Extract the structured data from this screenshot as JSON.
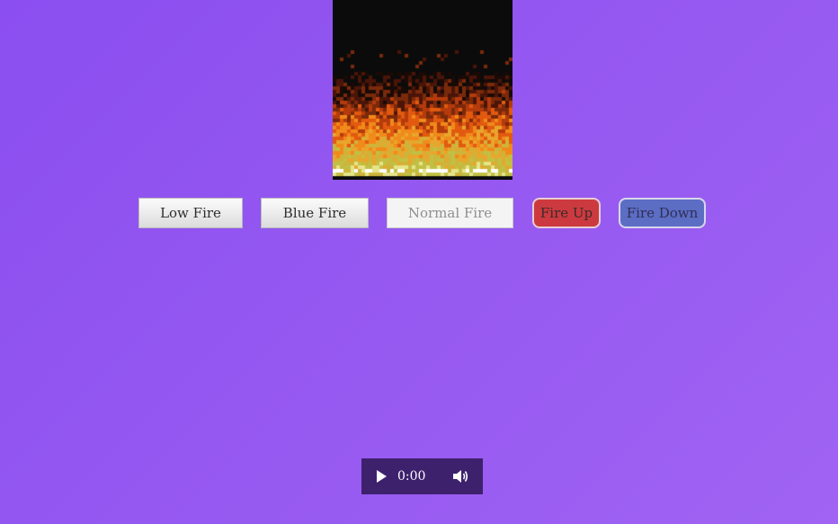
{
  "fire": {
    "preset": "Normal Fire",
    "colors": {
      "background": "#0b0b0b",
      "palette": [
        "#1a0a05",
        "#4a1508",
        "#7a2a0a",
        "#b53b0c",
        "#e25a0f",
        "#f08a1a",
        "#e8a62c",
        "#cdb43a",
        "#c0c044",
        "#e6e48a",
        "#ffffff"
      ]
    }
  },
  "buttons": {
    "low_fire": "Low Fire",
    "blue_fire": "Blue Fire",
    "normal_fire": "Normal Fire",
    "fire_up": "Fire Up",
    "fire_down": "Fire Down"
  },
  "audio": {
    "time": "0:00",
    "play_icon": "play-icon",
    "volume_icon": "volume-icon"
  }
}
